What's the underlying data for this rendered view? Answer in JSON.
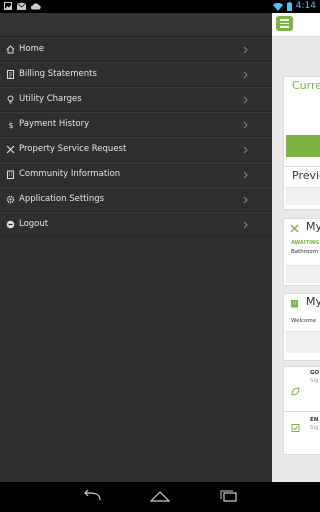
{
  "status_bar": {
    "time": "4:14",
    "icons_left": [
      "image-icon",
      "email-icon",
      "cloud-icon"
    ],
    "icons_right": [
      "wifi-icon",
      "battery-icon"
    ]
  },
  "drawer": {
    "items": [
      {
        "label": "Home",
        "icon": "home-icon"
      },
      {
        "label": "Billing Statements",
        "icon": "document-icon"
      },
      {
        "label": "Utility Charges",
        "icon": "lightbulb-icon"
      },
      {
        "label": "Payment History",
        "icon": "dollar-icon"
      },
      {
        "label": "Property Service Request",
        "icon": "tools-icon"
      },
      {
        "label": "Community Information",
        "icon": "building-icon"
      },
      {
        "label": "Application Settings",
        "icon": "gear-icon"
      },
      {
        "label": "Logout",
        "icon": "logout-icon"
      }
    ]
  },
  "main": {
    "current_card_title": "Curre",
    "previous_card_title": "Previo",
    "service_card": {
      "title": "My",
      "status": "AWAITING",
      "text": "Bathroom"
    },
    "info_card": {
      "title": "My",
      "text": "Welcome"
    },
    "go_item": {
      "title": "GO",
      "subtitle": "Sig"
    },
    "en_item": {
      "title": "EN",
      "subtitle": "Sig"
    }
  },
  "colors": {
    "accent": "#7cb342",
    "drawer_bg": "#2f2f2f"
  }
}
